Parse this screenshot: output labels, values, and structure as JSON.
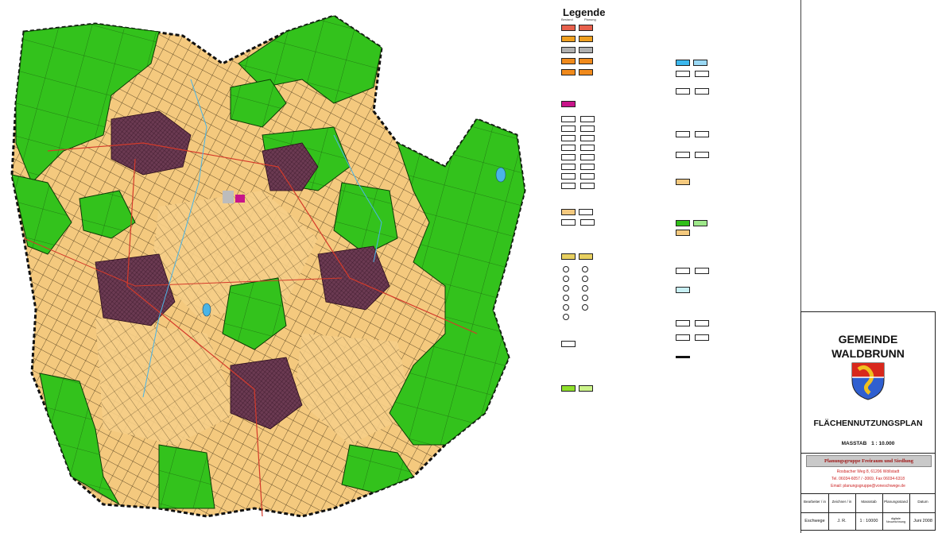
{
  "legend": {
    "title": "Legende",
    "col_left": "Bestand",
    "col_right": "Planung"
  },
  "title_block": {
    "municipality_line1": "GEMEINDE",
    "municipality_line2": "WALDBRUNN",
    "plan_title": "FLÄCHENNUTZUNGSPLAN",
    "scale_label": "MASSTAB",
    "scale_value": "1 : 10.000",
    "firm_name": "Planungsgruppe Freiraum und Siedlung",
    "firm_address": "Rosbacher Weg 8, 61206 Wöllstadt",
    "firm_phone": "Tel. 06034-6057 / -3069, Fax 06034-6318",
    "firm_email": "Email: planungsgruppe@voneschwege.de",
    "table_headers": [
      "Bearbeiter / in",
      "Zeichner / in",
      "Massstab",
      "Planungsstand",
      "Datum"
    ],
    "table_values": [
      "Eschwege",
      "J. R.",
      "1 : 10000",
      "digitale Neuzeichnung",
      "Juni 2008"
    ]
  },
  "colors": {
    "settlement": "#f4c97e",
    "forest": "#2fbf18",
    "village_core": "#5a2a40",
    "boundary": "#111111",
    "water": "#4ab4e6",
    "road": "#d43a2a"
  }
}
